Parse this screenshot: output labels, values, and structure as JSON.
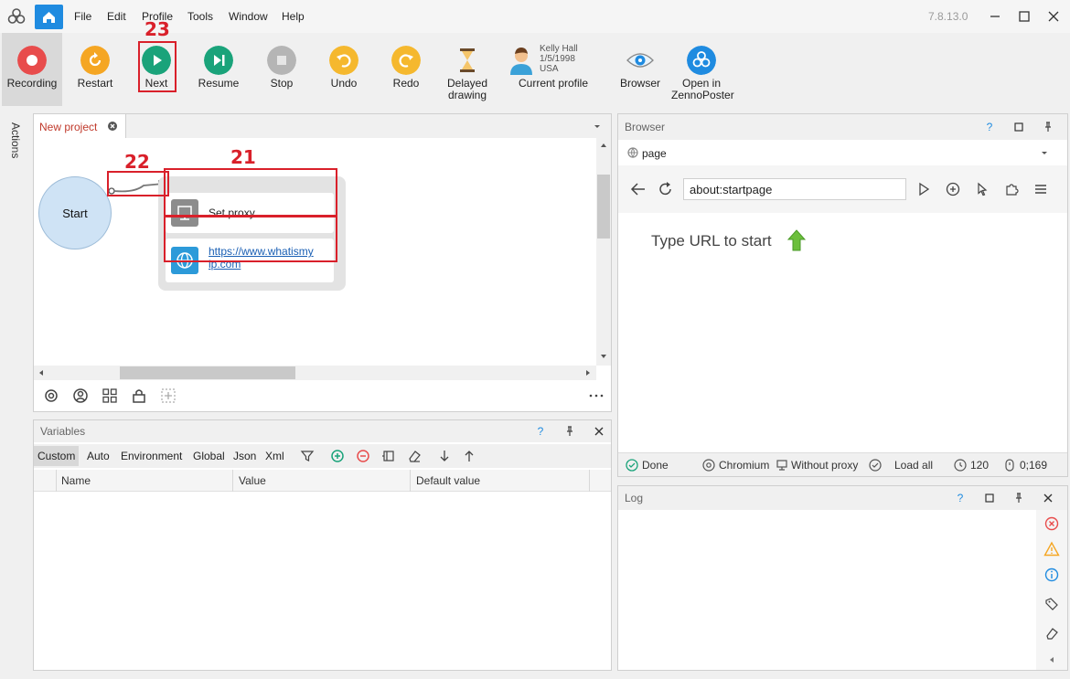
{
  "menu": {
    "items": [
      "File",
      "Edit",
      "Profile",
      "Tools",
      "Window",
      "Help"
    ],
    "version": "7.8.13.0"
  },
  "toolbar": {
    "recording": "Recording",
    "restart": "Restart",
    "next": "Next",
    "resume": "Resume",
    "stop": "Stop",
    "undo": "Undo",
    "redo": "Redo",
    "delayed_1": "Delayed",
    "delayed_2": "drawing",
    "profile_name": "Kelly Hall",
    "profile_date": "1/5/1998",
    "profile_country": "USA",
    "current_profile": "Current profile",
    "browser": "Browser",
    "open_1": "Open in",
    "open_2": "ZennoPoster"
  },
  "annotations": {
    "a21": "21",
    "a22": "22",
    "a23": "23"
  },
  "left_tab": {
    "label": "Actions"
  },
  "project": {
    "tab_label": "New project",
    "start": "Start",
    "block1": "Set proxy",
    "block2_line1": "https://www.whatismy",
    "block2_line2": "ip.com"
  },
  "variables": {
    "title": "Variables",
    "tabs": [
      "Custom",
      "Auto",
      "Environment",
      "Global",
      "Json",
      "Xml"
    ],
    "columns": [
      "Name",
      "Value",
      "Default value"
    ]
  },
  "browser": {
    "title": "Browser",
    "tab": "page",
    "address": "about:startpage",
    "prompt": "Type URL to start",
    "status": {
      "done": "Done",
      "engine": "Chromium",
      "proxy": "Without proxy",
      "load": "Load all",
      "timeout": "120",
      "counter": "0;169"
    }
  },
  "log": {
    "title": "Log"
  },
  "colors": {
    "accent": "#1f8be0",
    "record": "#e84c4c",
    "orange": "#f5a623",
    "green": "#1aa37a",
    "annotation": "#d9202a"
  }
}
